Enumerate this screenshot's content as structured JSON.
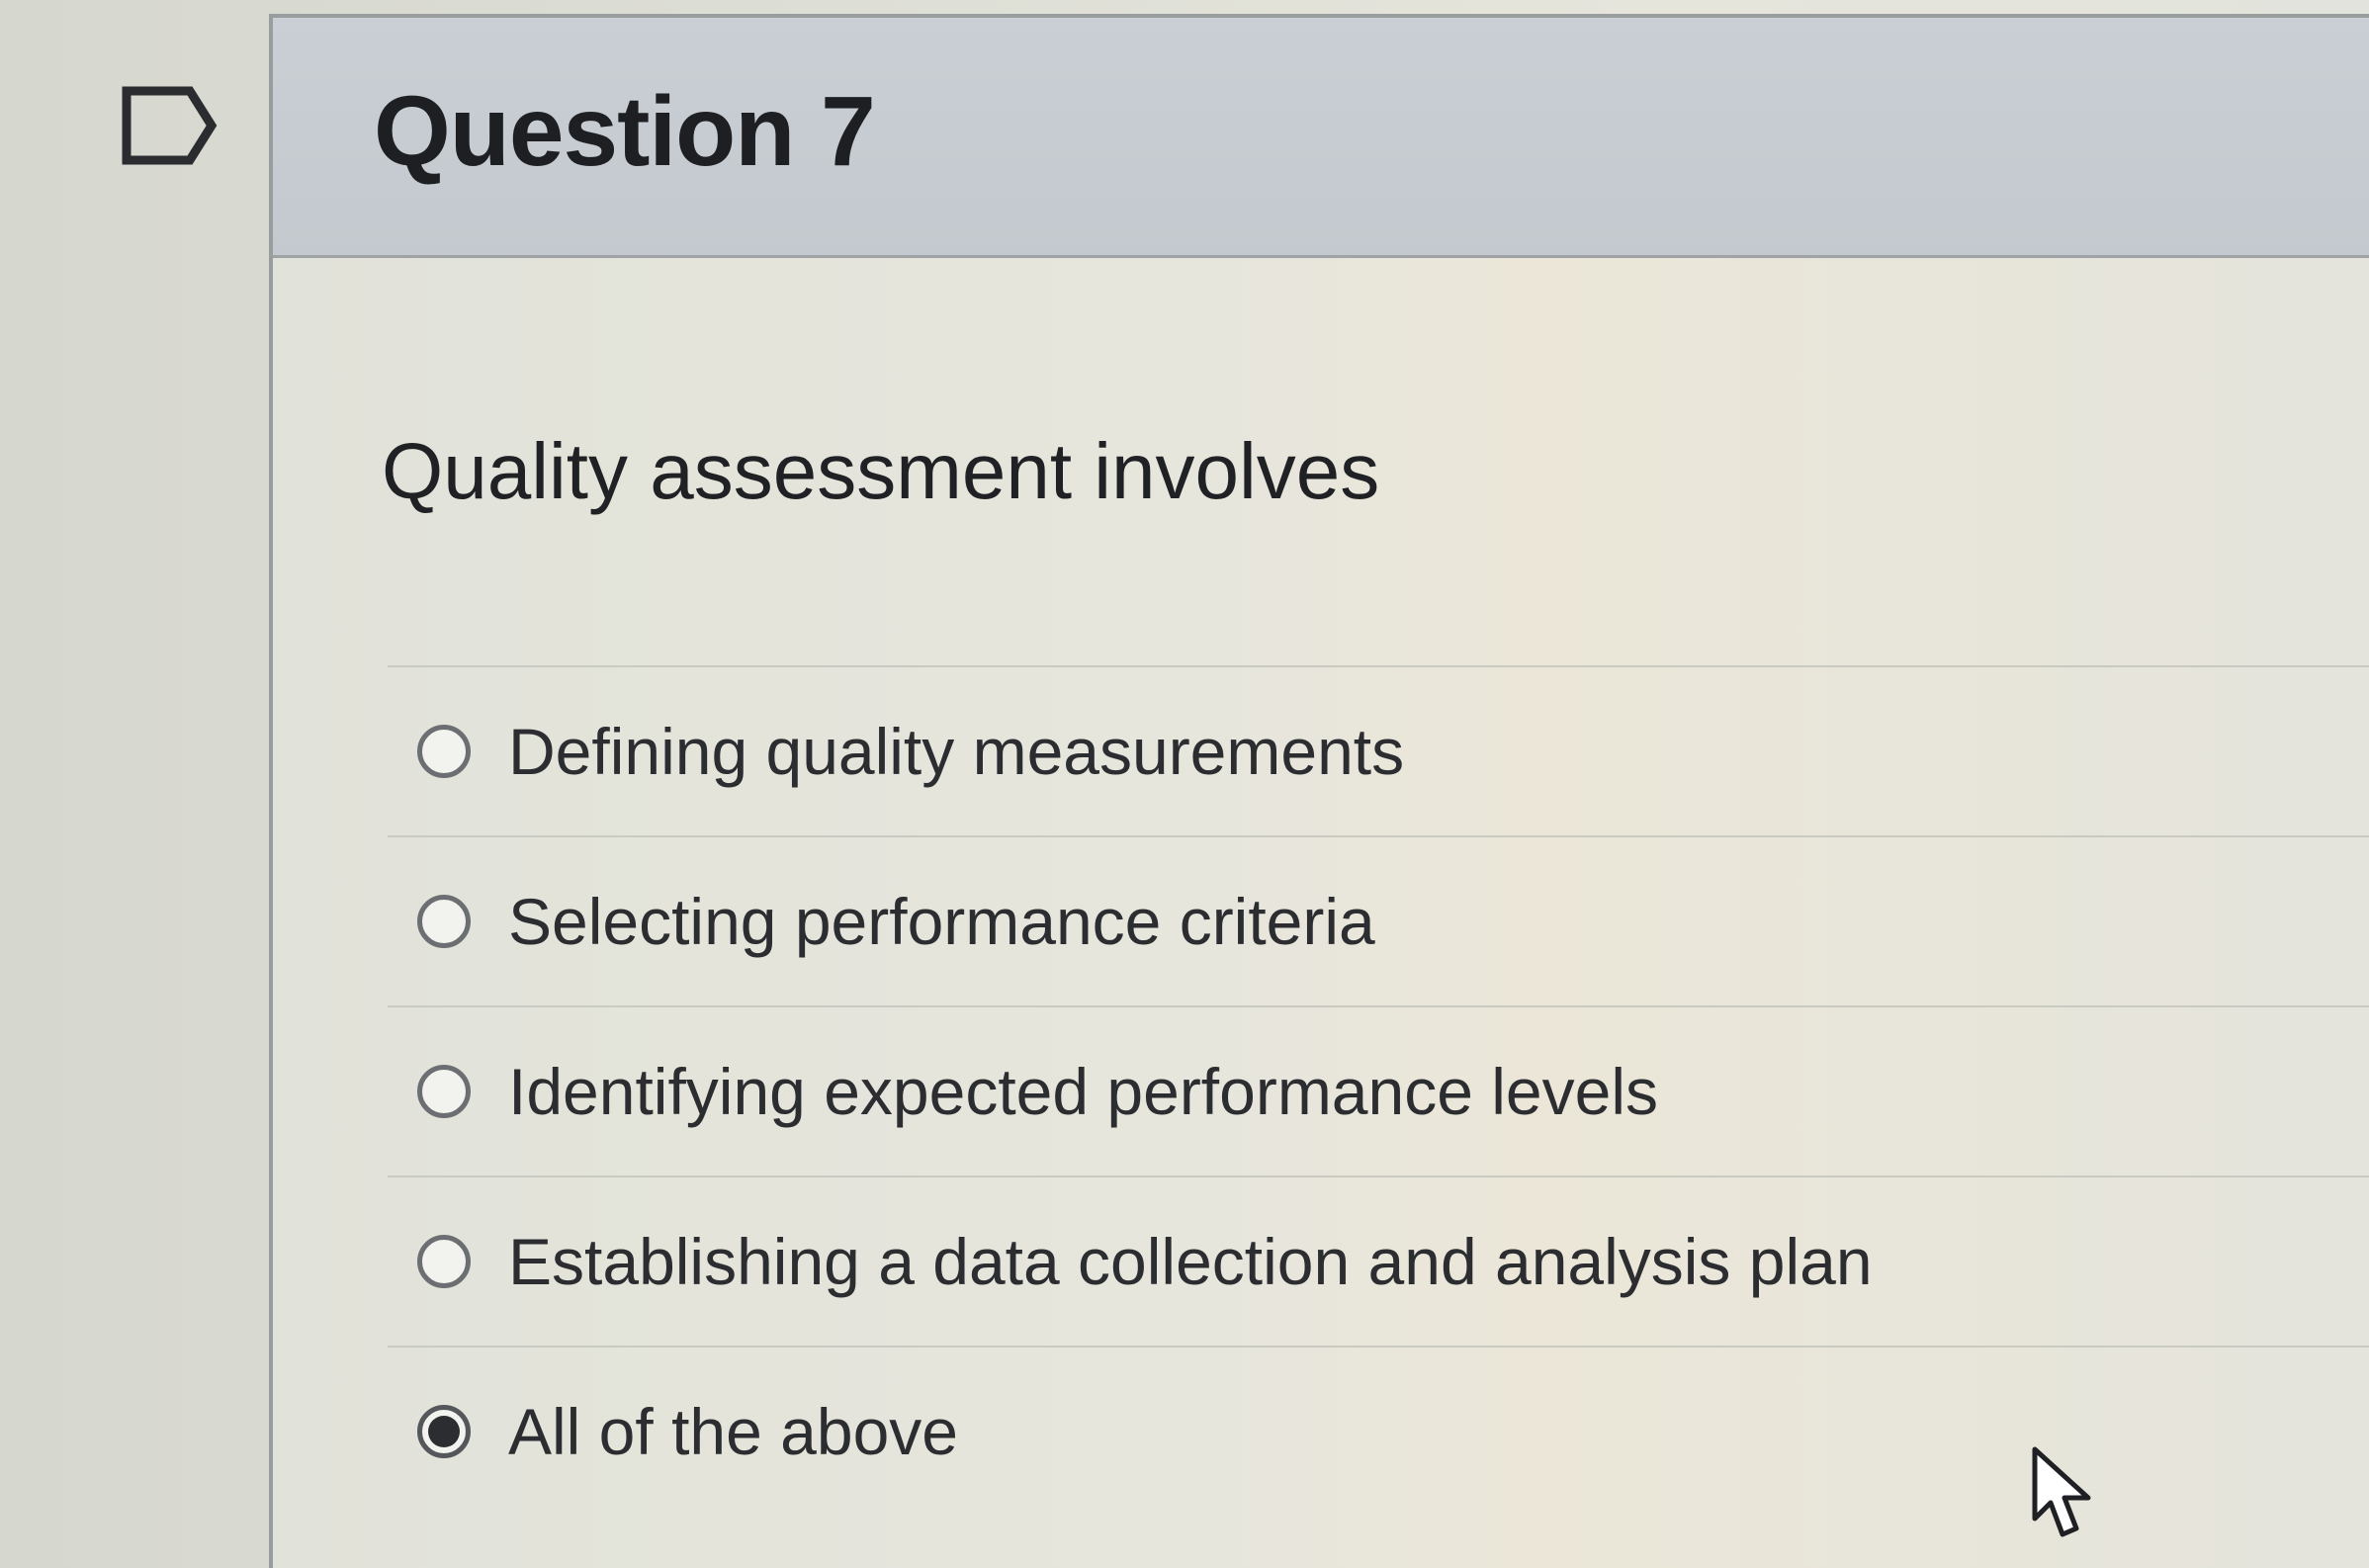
{
  "question": {
    "title": "Question 7",
    "text": "Quality assessment involves",
    "answers": [
      {
        "label": "Defining quality measurements",
        "selected": false
      },
      {
        "label": "Selecting performance criteria",
        "selected": false
      },
      {
        "label": "Identifying expected performance levels",
        "selected": false
      },
      {
        "label": "Establishing a data collection and analysis plan",
        "selected": false
      },
      {
        "label": "All of the above",
        "selected": true
      }
    ]
  },
  "icons": {
    "flag": "flag-question-icon",
    "cursor": "mouse-pointer-icon"
  },
  "colors": {
    "header_bg": "#c6ccd1",
    "body_bg": "#e4e4db",
    "text": "#1f2124",
    "radio_border": "#6c6f72"
  }
}
